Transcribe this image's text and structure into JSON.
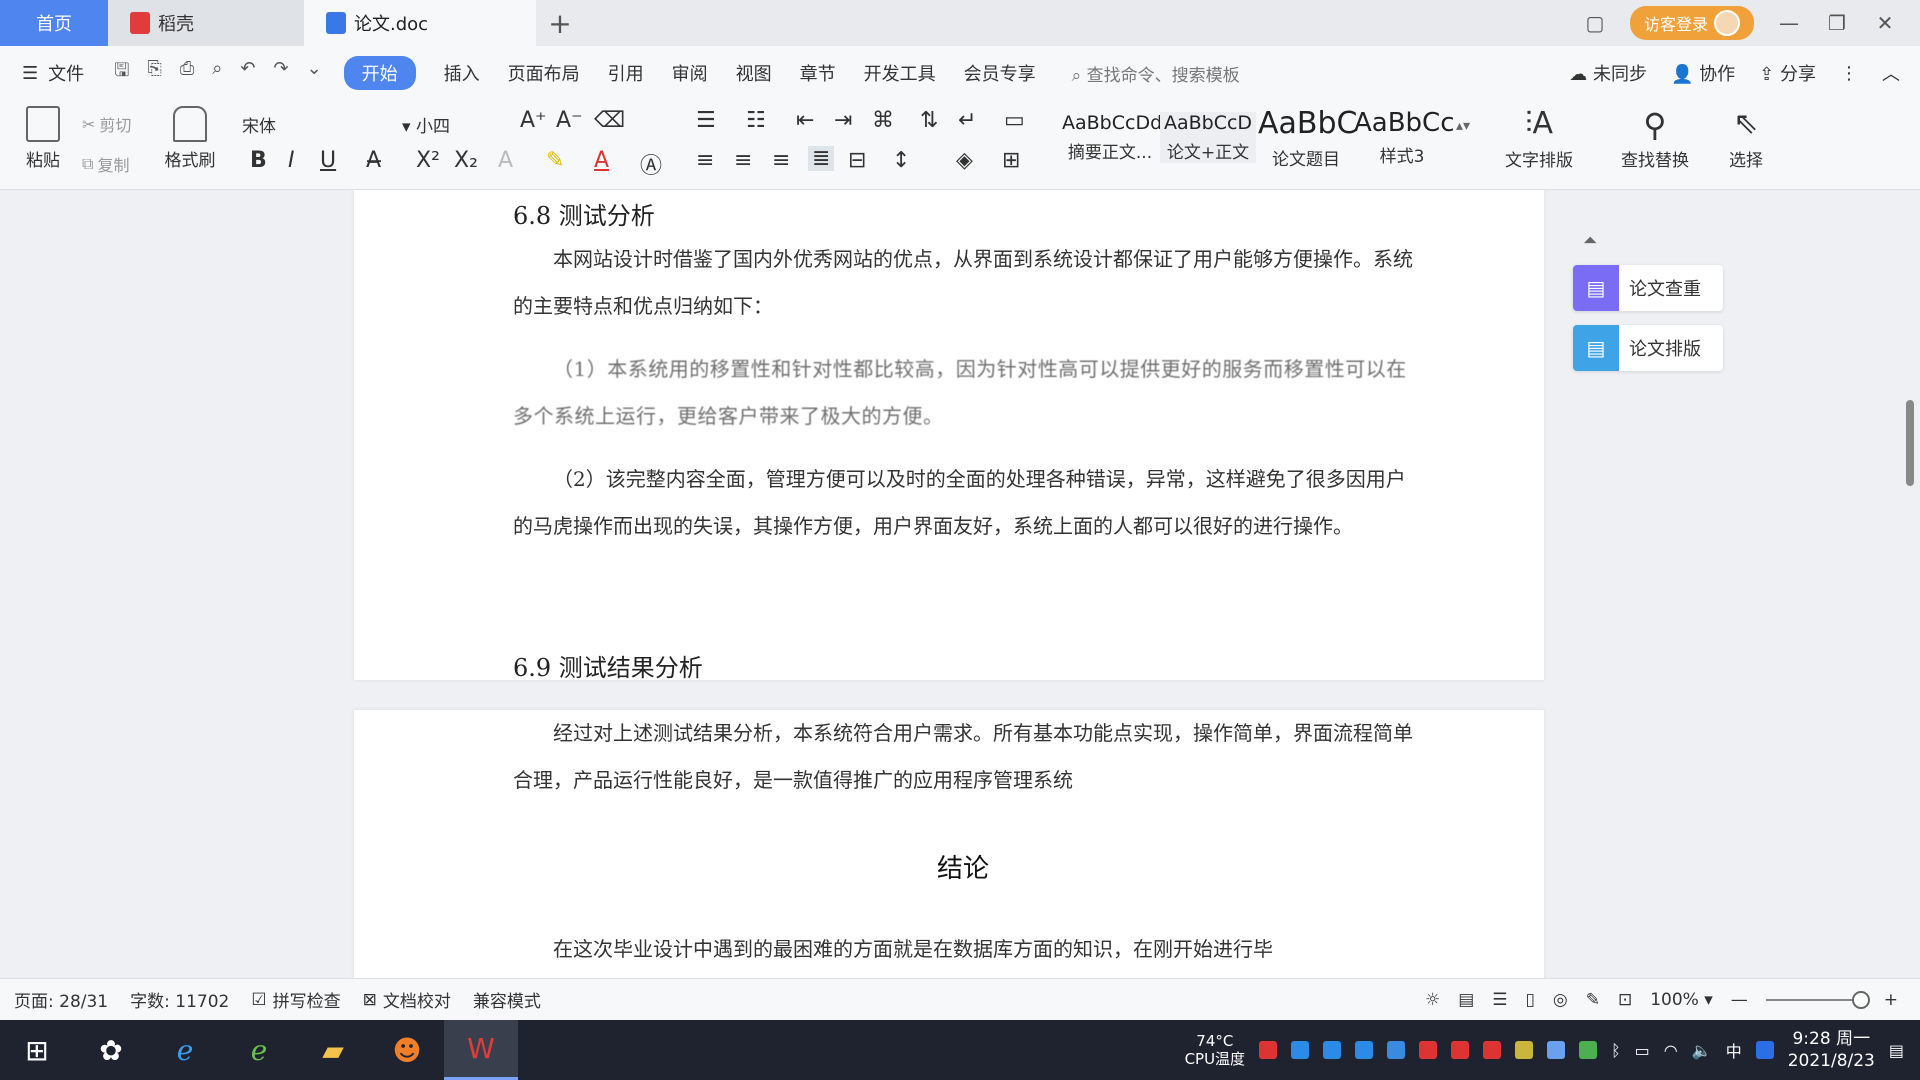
{
  "titlebar": {
    "home_tab": "首页",
    "wps_tab": "稻壳",
    "doc_tab": "论文.doc",
    "add_tab": "+",
    "login": "访客登录"
  },
  "menubar": {
    "file": "文件",
    "tabs": [
      "开始",
      "插入",
      "页面布局",
      "引用",
      "审阅",
      "视图",
      "章节",
      "开发工具",
      "会员专享"
    ],
    "search": "查找命令、搜索模板",
    "sync": "未同步",
    "collab": "协作",
    "share": "分享"
  },
  "ribbon": {
    "paste": "粘贴",
    "cut": "剪切",
    "copy": "复制",
    "format_painter": "格式刷",
    "font_name": "宋体",
    "font_size": "小四",
    "styles": [
      {
        "sample": "AaBbCcDd",
        "label": "摘要正文..."
      },
      {
        "sample": "AaBbCcD",
        "label": "论文+正文"
      },
      {
        "sample": "AaBbC",
        "label": "论文题目"
      },
      {
        "sample": "AaBbCc",
        "label": "样式3"
      }
    ],
    "text_layout": "文字排版",
    "find_replace": "查找替换",
    "select": "选择"
  },
  "document": {
    "heading1": "6.8 测试分析",
    "p1": "本网站设计时借鉴了国内外优秀网站的优点，从界面到系统设计都保证了用户能够方便操作。系统的主要特点和优点归纳如下：",
    "p2": "（1）本系统用的移置性和针对性都比较高，因为针对性高可以提供更好的服务而移置性可以在多个系统上运行，更给客户带来了极大的方便。",
    "p3": "（2）该完整内容全面，管理方便可以及时的全面的处理各种错误，异常，这样避免了很多因用户的马虎操作而出现的失误，其操作方便，用户界面友好，系统上面的人都可以很好的进行操作。",
    "heading2": "6.9 测试结果分析",
    "p4": "经过对上述测试结果分析，本系统符合用户需求。所有基本功能点实现，操作简单，界面流程简单合理，产品运行性能良好，是一款值得推广的应用程序管理系统",
    "conclusion": "结论",
    "p5": "在这次毕业设计中遇到的最困难的方面就是在数据库方面的知识，在刚开始进行毕"
  },
  "sidepanel": {
    "check": "论文查重",
    "layout": "论文排版"
  },
  "statusbar": {
    "page": "页面: 28/31",
    "words": "字数: 11702",
    "spell": "拼写检查",
    "proof": "文档校对",
    "compat": "兼容模式",
    "zoom": "100%",
    "zoom_level": 0.95
  },
  "taskbar": {
    "cpu_temp": "74°C",
    "cpu_label": "CPU温度",
    "ime": "中",
    "time": "9:28 周一",
    "date": "2021/8/23"
  },
  "colors": {
    "accent": "#4f85ee",
    "login": "#f0a13a",
    "side_check": "#7b6cf6",
    "side_layout": "#3fa3e8"
  }
}
